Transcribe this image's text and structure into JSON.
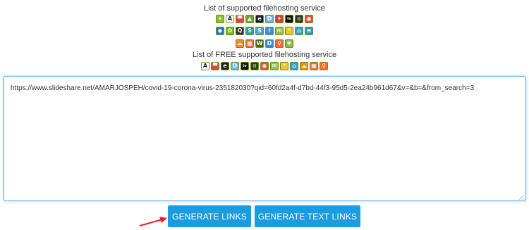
{
  "supported_heading": "List of supported filehosting service",
  "free_heading": "List of FREE supported filehosting service",
  "supported_rows": [
    [
      {
        "name": "bug-icon",
        "bg": "#8bbf3a",
        "glyph": "✶"
      },
      {
        "name": "letter-a-icon",
        "bg": "#ffffff",
        "glyph": "A",
        "fg": "#222222"
      },
      {
        "name": "red-square-icon",
        "bg": "#e0473a",
        "glyph": "▀"
      },
      {
        "name": "triangle-icon",
        "bg": "#6aa628",
        "glyph": "▲"
      },
      {
        "name": "letter-e-icon",
        "bg": "#1f1f1f",
        "glyph": "e"
      },
      {
        "name": "letter-d-icon",
        "bg": "#67b6e8",
        "glyph": "D"
      },
      {
        "name": "red-leaf-icon",
        "bg": "#c9472c",
        "glyph": "✦"
      },
      {
        "name": "tv-icon",
        "bg": "#111111",
        "glyph": "tv"
      },
      {
        "name": "audio-wave-icon",
        "bg": "#2f3b16",
        "glyph": "|||"
      },
      {
        "name": "record-icon",
        "bg": "#ec4a3a",
        "glyph": "◉"
      }
    ],
    [
      {
        "name": "blue-logo-icon",
        "bg": "#2b77c9",
        "glyph": "◆"
      },
      {
        "name": "green-bird-icon",
        "bg": "#76b82e",
        "glyph": "✿"
      },
      {
        "name": "q-icon",
        "bg": "#2f2f2f",
        "glyph": "Q"
      },
      {
        "name": "letter-s-icon",
        "bg": "#27a3a0",
        "glyph": "S"
      },
      {
        "name": "letter-s-box-icon",
        "bg": "#4aa6d8",
        "glyph": "S"
      },
      {
        "name": "upload-arrow-icon",
        "bg": "#3a8edb",
        "glyph": "⇧"
      },
      {
        "name": "message-icon",
        "bg": "#9bbf4a",
        "glyph": "✉"
      },
      {
        "name": "quote-icon",
        "bg": "#f2c230",
        "glyph": "❝"
      },
      {
        "name": "basket-icon",
        "bg": "#2e9ed8",
        "glyph": "⌂"
      },
      {
        "name": "database-icon",
        "bg": "#1f9ad6",
        "glyph": "≡"
      }
    ],
    [
      {
        "name": "cloud-icon",
        "bg": "#f28a24",
        "glyph": "☁"
      },
      {
        "name": "grid-icon",
        "bg": "#e8732e",
        "glyph": "▦"
      },
      {
        "name": "letter-w-icon",
        "bg": "#4a6a1a",
        "glyph": "W"
      },
      {
        "name": "letter-d-round-icon",
        "bg": "#2f8fe0",
        "glyph": "D"
      },
      {
        "name": "swirl-icon",
        "bg": "#f26a2e",
        "glyph": "♀"
      },
      {
        "name": "cat-icon",
        "bg": "#86b84a",
        "glyph": "✾"
      }
    ]
  ],
  "free_row": [
    {
      "name": "letter-a-icon",
      "bg": "#ffffff",
      "glyph": "A",
      "fg": "#222222"
    },
    {
      "name": "red-square-icon",
      "bg": "#e0473a",
      "glyph": "▀"
    },
    {
      "name": "letter-e-icon",
      "bg": "#1f1f1f",
      "glyph": "e"
    },
    {
      "name": "letter-d-icon",
      "bg": "#67b6e8",
      "glyph": "D"
    },
    {
      "name": "tv-icon",
      "bg": "#111111",
      "glyph": "tv"
    },
    {
      "name": "audio-wave-icon",
      "bg": "#2f3b16",
      "glyph": "|||"
    },
    {
      "name": "record-icon",
      "bg": "#ec4a3a",
      "glyph": "◉"
    },
    {
      "name": "message-icon",
      "bg": "#9bbf4a",
      "glyph": "✉"
    },
    {
      "name": "quote-icon",
      "bg": "#f2c230",
      "glyph": "❝"
    },
    {
      "name": "basket-icon",
      "bg": "#2e9ed8",
      "glyph": "⌂"
    },
    {
      "name": "cloud-icon",
      "bg": "#f28a24",
      "glyph": "☁"
    },
    {
      "name": "grid-icon",
      "bg": "#e8732e",
      "glyph": "▦"
    },
    {
      "name": "swirl-icon",
      "bg": "#f26a2e",
      "glyph": "♀"
    }
  ],
  "url_input": {
    "value": "https://www.slideshare.net/AMARJOSPEH/covid-19-corona-virus-235182030?qid=60fd2a4f-d7bd-44f3-95d5-2ea24b961d67&v=&b=&from_search=3"
  },
  "buttons": {
    "generate_links": "GENERATE LINKS",
    "generate_text_links": "GENERATE TEXT LINKS"
  },
  "colors": {
    "button_bg": "#1a9cde",
    "focus_border": "#66afe9",
    "arrow": "#e8202a",
    "icon_border": "#6f8f14"
  }
}
